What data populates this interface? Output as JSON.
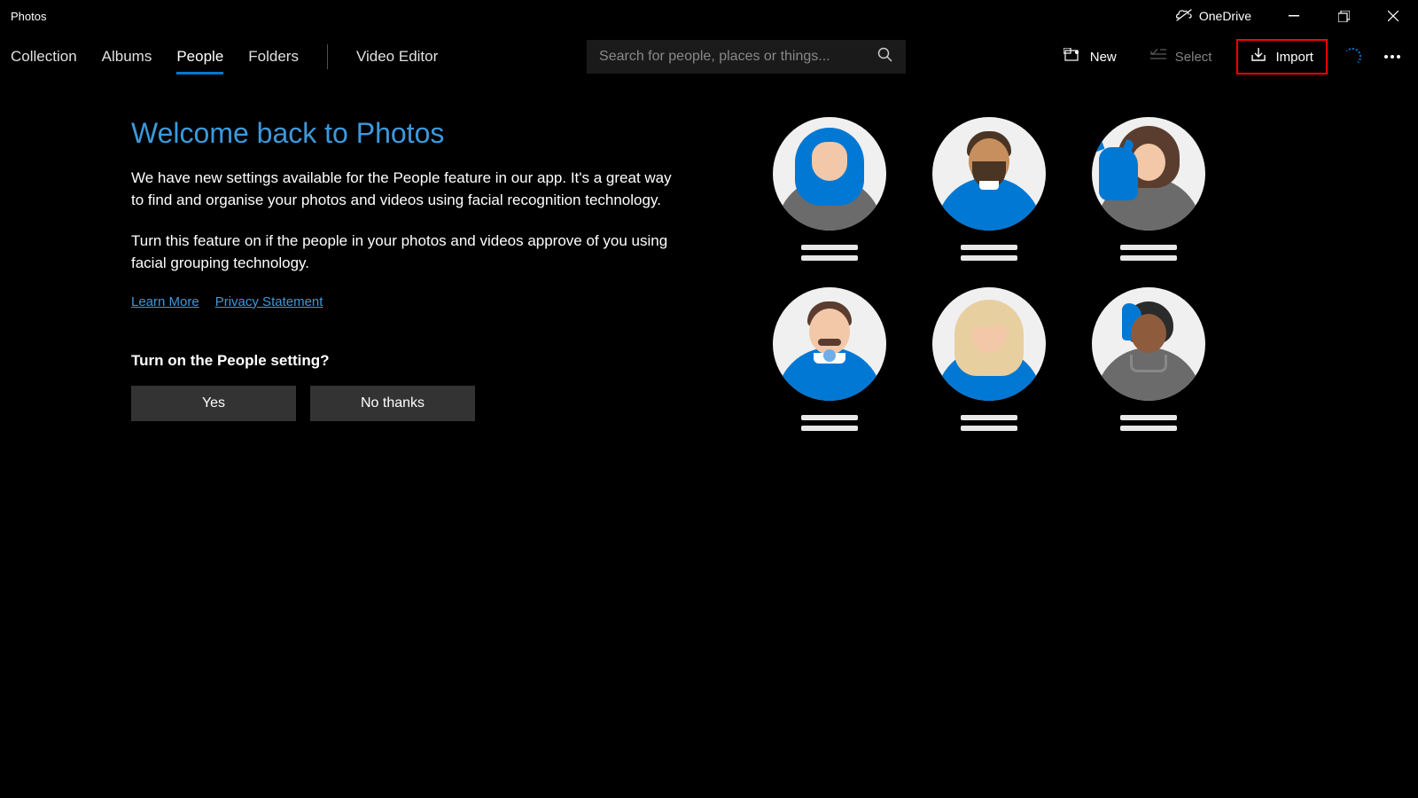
{
  "window": {
    "title": "Photos",
    "cloud": "OneDrive"
  },
  "nav": {
    "tabs": [
      {
        "label": "Collection",
        "active": false
      },
      {
        "label": "Albums",
        "active": false
      },
      {
        "label": "People",
        "active": true
      },
      {
        "label": "Folders",
        "active": false
      }
    ],
    "video_editor": "Video Editor"
  },
  "search": {
    "placeholder": "Search for people, places or things..."
  },
  "actions": {
    "new": "New",
    "select": "Select",
    "import": "Import"
  },
  "welcome": {
    "title": "Welcome back to Photos",
    "p1": "We have new settings available for the People feature in our app. It's a great way to find and organise your photos and videos using facial recognition technology.",
    "p2": "Turn this feature on if the people in your photos and videos approve of you using facial grouping technology.",
    "learn_more": "Learn More",
    "privacy": "Privacy Statement",
    "prompt": "Turn on the People setting?",
    "yes": "Yes",
    "no": "No thanks"
  },
  "avatar_alt": [
    "person-hijab",
    "person-beard",
    "person-with-cat",
    "person-mustache",
    "person-blonde",
    "person-short-hair"
  ]
}
